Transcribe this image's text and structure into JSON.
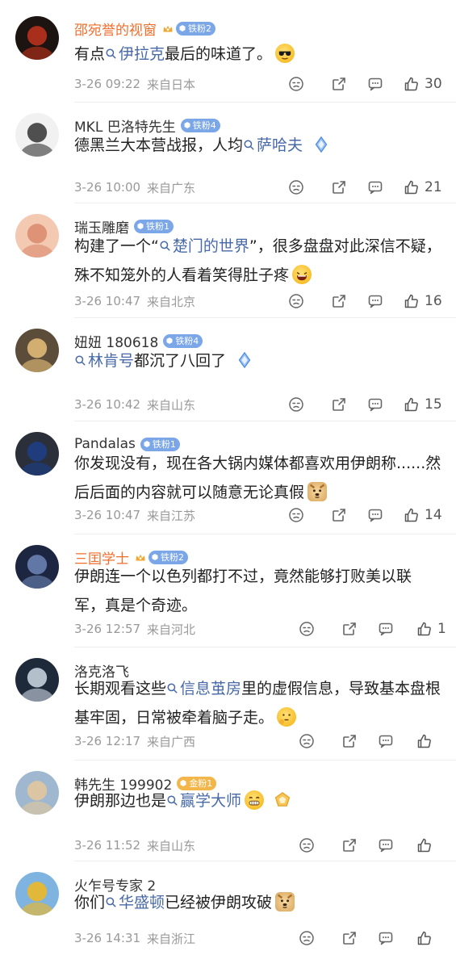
{
  "comments": [
    {
      "username": "邵宛誉的视窗",
      "name_color": "orange",
      "vip": true,
      "badge": {
        "label": "铁粉2",
        "kind": "blue"
      },
      "avatar": {
        "bg": "#1c1410",
        "accent": "#c2321d"
      },
      "segments": [
        {
          "t": "text",
          "v": "有点"
        },
        {
          "t": "topic",
          "v": "伊拉克"
        },
        {
          "t": "text",
          "v": "最后的味道了。"
        },
        {
          "t": "emoji",
          "v": "sunglasses"
        }
      ],
      "time": "3-26 09:22",
      "location": "来自日本",
      "likes": "30"
    },
    {
      "username": "MKL 巴洛特先生",
      "name_color": "default",
      "vip": false,
      "badge": {
        "label": "铁粉4",
        "kind": "blue"
      },
      "avatar": {
        "bg": "#f1f1f1",
        "accent": "#333333"
      },
      "segments": [
        {
          "t": "text",
          "v": "德黑兰大本营战报，人均"
        },
        {
          "t": "topic",
          "v": "萨哈夫"
        },
        {
          "t": "sticker",
          "v": "diamond"
        }
      ],
      "time": "3-26 10:00",
      "location": "来自广东",
      "likes": "21"
    },
    {
      "username": "瑞玉雕磨",
      "name_color": "default",
      "vip": false,
      "badge": {
        "label": "铁粉1",
        "kind": "blue"
      },
      "avatar": {
        "bg": "#f4c9b2",
        "accent": "#d9896c"
      },
      "segments": [
        {
          "t": "text",
          "v": "构建了一个“"
        },
        {
          "t": "topic",
          "v": "楚门的世界"
        },
        {
          "t": "text",
          "v": "”，很多盘盘对此深信不疑，殊不知笼外的人看着笑得肚子疼"
        },
        {
          "t": "emoji",
          "v": "laugh"
        }
      ],
      "time": "3-26 10:47",
      "location": "来自北京",
      "likes": "16"
    },
    {
      "username": "妞妞 180618",
      "name_color": "default",
      "vip": false,
      "badge": {
        "label": "铁粉4",
        "kind": "blue"
      },
      "avatar": {
        "bg": "#5b4d3a",
        "accent": "#e8c17a"
      },
      "segments": [
        {
          "t": "topic",
          "v": "林肯号"
        },
        {
          "t": "text",
          "v": "都沉了八回了"
        },
        {
          "t": "sticker",
          "v": "diamond"
        }
      ],
      "time": "3-26 10:42",
      "location": "来自山东",
      "likes": "15"
    },
    {
      "username": "Pandalas",
      "name_color": "default",
      "vip": false,
      "badge": {
        "label": "铁粉1",
        "kind": "blue"
      },
      "avatar": {
        "bg": "#2a2f3a",
        "accent": "#1d3f8a"
      },
      "segments": [
        {
          "t": "text",
          "v": "你发现没有，现在各大锅内媒体都喜欢用伊朗称......然后后面的内容就可以随意无论真假"
        },
        {
          "t": "emoji",
          "v": "doge"
        }
      ],
      "time": "3-26 10:47",
      "location": "来自江苏",
      "likes": "14"
    },
    {
      "username": "三囯学士",
      "name_color": "orange",
      "vip": true,
      "badge": {
        "label": "铁粉2",
        "kind": "blue"
      },
      "avatar": {
        "bg": "#1d2640",
        "accent": "#6d86b8"
      },
      "segments": [
        {
          "t": "text",
          "v": "伊朗连一个以色列都打不过，竟然能够打败美以联军，真是个奇迹。"
        }
      ],
      "time": "3-26 12:57",
      "location": "来自河北",
      "likes": "1"
    },
    {
      "username": "洛克洛飞",
      "name_color": "default",
      "vip": false,
      "badge": null,
      "avatar": {
        "bg": "#1e2a3a",
        "accent": "#cfd9e6"
      },
      "segments": [
        {
          "t": "text",
          "v": "长期观看这些"
        },
        {
          "t": "topic",
          "v": "信息茧房"
        },
        {
          "t": "text",
          "v": "里的虚假信息，导致基本盘根基牢固，日常被牵着脑子走。"
        },
        {
          "t": "emoji",
          "v": "think"
        }
      ],
      "time": "3-26 12:17",
      "location": "来自广西",
      "likes": ""
    },
    {
      "username": "韩先生 199902",
      "name_color": "default",
      "vip": false,
      "badge": {
        "label": "金粉1",
        "kind": "gold"
      },
      "avatar": {
        "bg": "#9fb8cf",
        "accent": "#e6c79b"
      },
      "segments": [
        {
          "t": "text",
          "v": "伊朗那边也是"
        },
        {
          "t": "topic",
          "v": "赢学大师"
        },
        {
          "t": "emoji",
          "v": "grin"
        },
        {
          "t": "sticker",
          "v": "pentagon"
        }
      ],
      "time": "3-26 11:52",
      "location": "来自山东",
      "likes": ""
    },
    {
      "username": "火乍号专家 2",
      "name_color": "default",
      "vip": false,
      "badge": null,
      "avatar": {
        "bg": "#7fb4e0",
        "accent": "#f2b81c"
      },
      "segments": [
        {
          "t": "text",
          "v": "你们"
        },
        {
          "t": "topic",
          "v": "华盛顿"
        },
        {
          "t": "text",
          "v": "已经被伊朗攻破"
        },
        {
          "t": "emoji",
          "v": "doge"
        }
      ],
      "time": "3-26 14:31",
      "location": "来自浙江",
      "likes": ""
    }
  ]
}
